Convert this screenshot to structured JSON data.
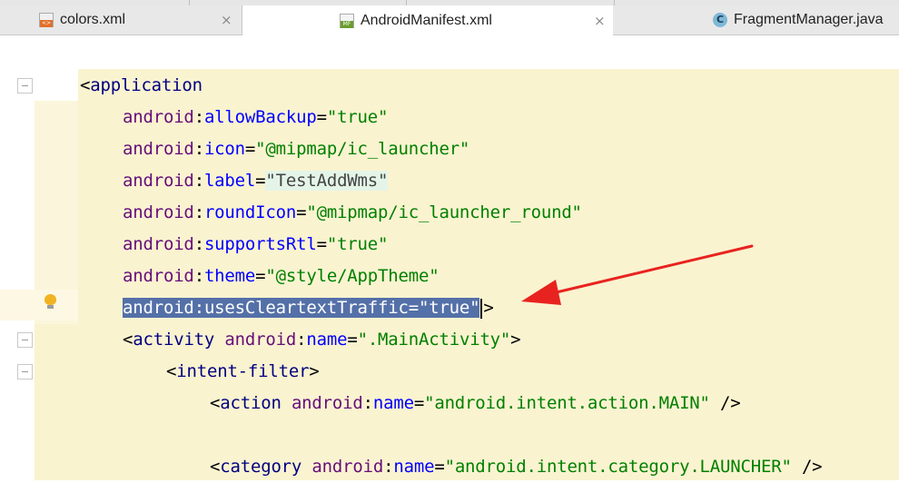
{
  "tabs": [
    {
      "label": "colors.xml",
      "icon": "xml-file-icon",
      "active": false
    },
    {
      "label": "AndroidManifest.xml",
      "icon": "manifest-file-icon",
      "active": true
    },
    {
      "label": "FragmentManager.java",
      "icon": "java-class-icon",
      "active": false
    }
  ],
  "close_glyph": "×",
  "code": {
    "l1": {
      "open": "<",
      "tag": "application"
    },
    "l2": {
      "ns": "android",
      "colon": ":",
      "attr": "allowBackup",
      "eq": "=",
      "val": "\"true\""
    },
    "l3": {
      "ns": "android",
      "colon": ":",
      "attr": "icon",
      "eq": "=",
      "val": "\"@mipmap/ic_launcher\""
    },
    "l4": {
      "ns": "android",
      "colon": ":",
      "attr": "label",
      "eq": "=",
      "val": "\"TestAddWms\""
    },
    "l5": {
      "ns": "android",
      "colon": ":",
      "attr": "roundIcon",
      "eq": "=",
      "val": "\"@mipmap/ic_launcher_round\""
    },
    "l6": {
      "ns": "android",
      "colon": ":",
      "attr": "supportsRtl",
      "eq": "=",
      "val": "\"true\""
    },
    "l7": {
      "ns": "android",
      "colon": ":",
      "attr": "theme",
      "eq": "=",
      "val": "\"@style/AppTheme\""
    },
    "l8": {
      "ns": "android",
      "colon": ":",
      "attr": "usesCleartextTraffic",
      "eq": "=",
      "val": "\"true\"",
      "close": ">"
    },
    "l9": {
      "open": "<",
      "tag": "activity",
      "ns": "android",
      "colon": ":",
      "attr": "name",
      "eq": "=",
      "val": "\".MainActivity\"",
      "close": ">"
    },
    "l10": {
      "open": "<",
      "tag": "intent-filter",
      "close": ">"
    },
    "l11": {
      "open": "<",
      "tag": "action",
      "ns": "android",
      "colon": ":",
      "attr": "name",
      "eq": "=",
      "val": "\"android.intent.action.MAIN\"",
      "close": " />"
    },
    "l12": {
      "open": "<",
      "tag": "category",
      "ns": "android",
      "colon": ":",
      "attr": "name",
      "eq": "=",
      "val": "\"android.intent.category.LAUNCHER\"",
      "close": " />"
    }
  },
  "colors": {
    "selection": "#5470a8",
    "arrow": "#e8231f",
    "tag": "#000080",
    "namespace": "#660e7a",
    "attribute": "#0000ff",
    "string": "#008000"
  }
}
